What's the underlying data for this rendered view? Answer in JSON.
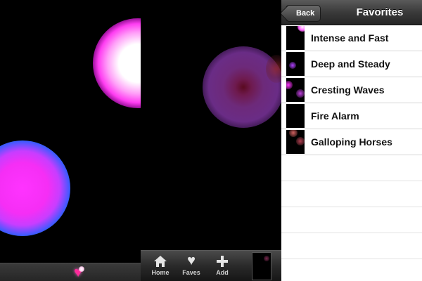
{
  "player": {
    "favorite_icon": "heart-icon"
  },
  "tabbar": {
    "items": [
      {
        "label": "Home",
        "icon": "home-icon"
      },
      {
        "label": "Faves",
        "icon": "heart-icon"
      },
      {
        "label": "Add",
        "icon": "plus-icon"
      }
    ]
  },
  "favorites": {
    "nav": {
      "back_label": "Back",
      "title": "Favorites"
    },
    "items": [
      {
        "label": "Intense and Fast"
      },
      {
        "label": "Deep and Steady"
      },
      {
        "label": "Cresting Waves"
      },
      {
        "label": "Fire Alarm"
      },
      {
        "label": "Galloping Horses"
      }
    ]
  },
  "colors": {
    "accent_pink": "#ff2a9a",
    "glow_magenta": "#ff33ff",
    "glow_purple": "#6a2c86",
    "navbar": "#3a3a3a"
  }
}
